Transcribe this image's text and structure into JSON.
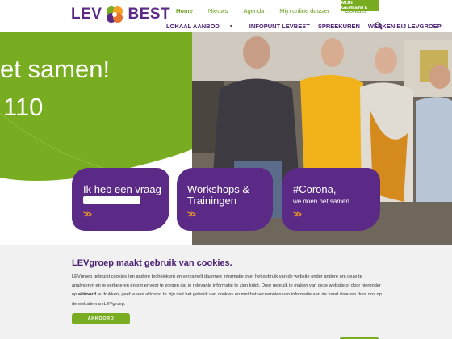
{
  "brand": {
    "logo_left": "LEV",
    "logo_right": "BEST",
    "colors": {
      "purple": "#5b2a86",
      "green": "#78ad22",
      "orange": "#f4a024"
    }
  },
  "topnav": {
    "items": [
      "Home",
      "Nieuws",
      "Agenda",
      "Mijn online dossier",
      "Contact"
    ],
    "active": "Home"
  },
  "mijn_gemeente": "MIJN GEMEENTE",
  "mainnav": {
    "items": [
      "LOKAAL AANBOD",
      "INFOPUNT LEVBEST",
      "SPREEKUREN",
      "WERKEN BIJ LEVGROEP"
    ]
  },
  "hero": {
    "line1": "et samen!",
    "line2": "110"
  },
  "cards": [
    {
      "title": "Ik heb een vraag",
      "arrows": ">>"
    },
    {
      "title": "Workshops & Trainingen",
      "arrows": ">>"
    },
    {
      "title": "#Corona,",
      "subtitle": "we doen het samen",
      "arrows": ">>"
    }
  ],
  "cookie": {
    "title": "LEVgroep maakt gebruik van cookies.",
    "text_before": "LEVgroep gebruikt cookies (en andere technieken) en verzamelt daarmee informatie over het gebruik van de website onder andere om deze te analyseren en te verbeteren én om er voor te zorgen dat je relevante informatie te zien krijgt. Door gebruik te maken van deze website of door hieronder op ",
    "text_bold": "akkoord",
    "text_after": " te drukken, geef je aan akkoord te zijn met het gebruik van cookies en met het verzamelen van informatie aan de hand daarvan door ons op de website van LEVgroep.",
    "button": "AKKOORD"
  }
}
